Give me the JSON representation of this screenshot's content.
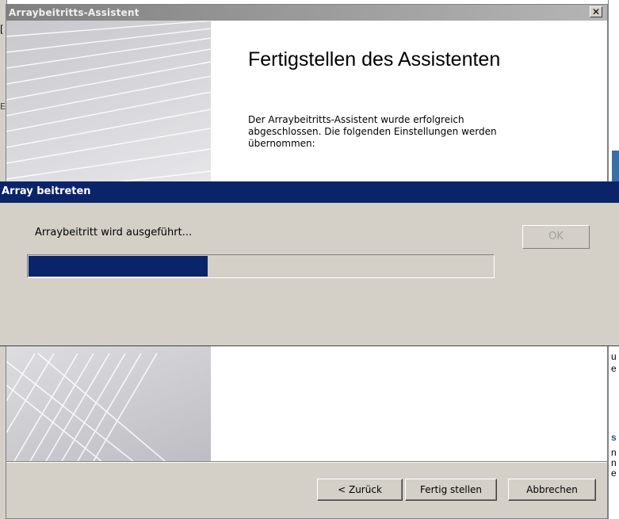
{
  "wizard": {
    "title": "Arraybeitritts-Assistent",
    "close_glyph": "✕",
    "heading": "Fertigstellen des Assistenten",
    "description": "Der Arraybeitritts-Assistent wurde erfolgreich abgeschlossen. Die folgenden Einstellungen werden übernommen:",
    "buttons": {
      "back": "< Zurück",
      "finish": "Fertig stellen",
      "cancel": "Abbrechen"
    }
  },
  "dialog": {
    "title": "Array beitreten",
    "message": "Arraybeitritt wird ausgeführt...",
    "ok_label": "OK",
    "progress_fraction": 0.385,
    "progress_color": "#0a246a"
  },
  "background": {
    "left_fragments": [
      "[",
      "E"
    ],
    "right_fragments": [
      "u",
      "e",
      "s",
      "n",
      "n",
      "e"
    ]
  },
  "colors": {
    "titlebar_active": "#0a246a",
    "titlebar_inactive": "#808080",
    "face": "#d4d0c8"
  }
}
